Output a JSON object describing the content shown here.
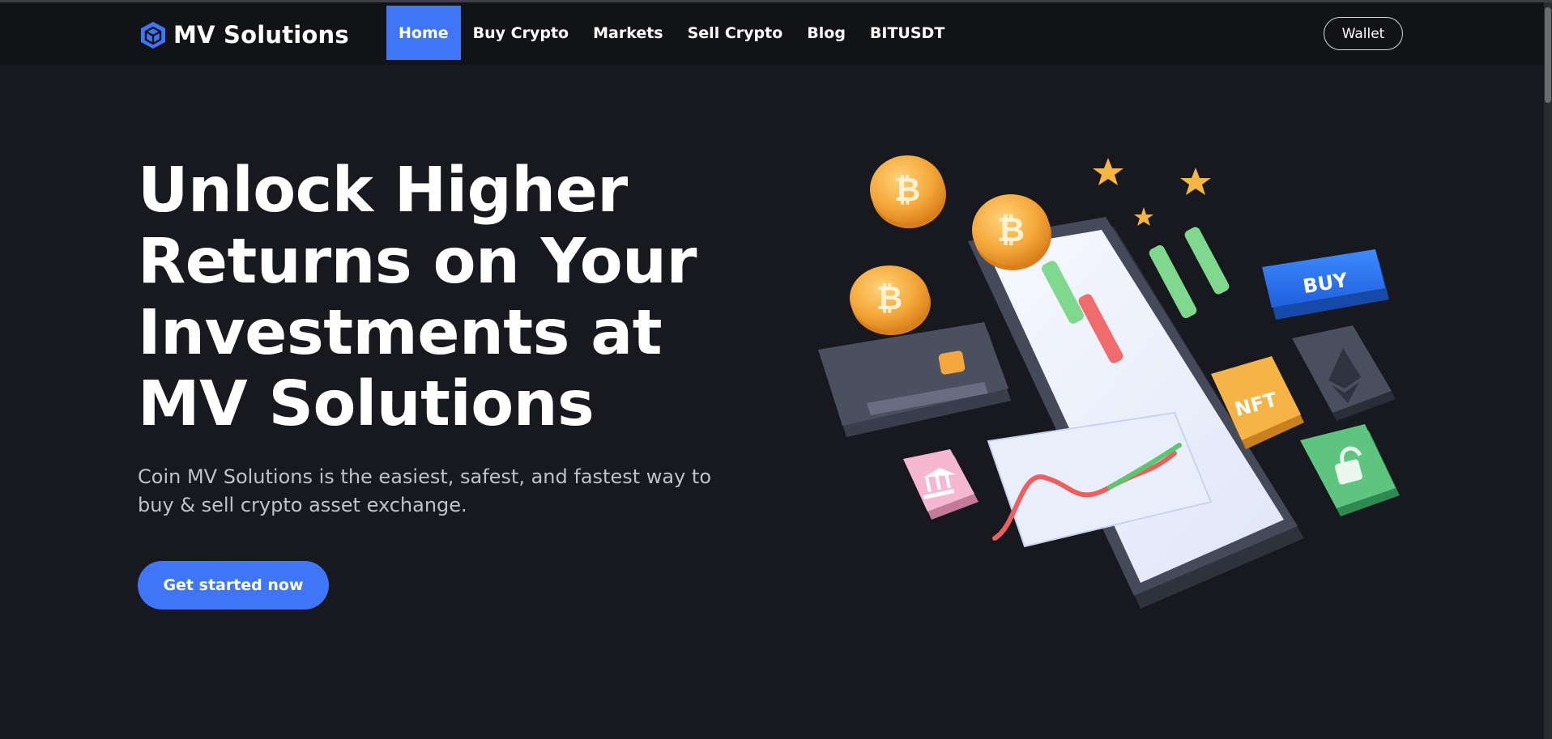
{
  "navbar": {
    "brand": "MV Solutions",
    "items": [
      {
        "label": "Home",
        "active": true
      },
      {
        "label": "Buy Crypto",
        "active": false
      },
      {
        "label": "Markets",
        "active": false
      },
      {
        "label": "Sell Crypto",
        "active": false
      },
      {
        "label": "Blog",
        "active": false
      },
      {
        "label": "BITUSDT",
        "active": false
      }
    ],
    "wallet_label": "Wallet"
  },
  "hero": {
    "title_lines": [
      "Unlock Higher",
      "Returns on Your",
      "Investments at",
      "MV Solutions"
    ],
    "subtitle": "Coin MV Solutions is the easiest, safest, and fastest way to buy & sell crypto asset exchange.",
    "cta_label": "Get started now"
  },
  "illustration": {
    "buy_tile_label": "BUY",
    "nft_tile_label": "NFT",
    "icons": [
      "bitcoin-coin-icon",
      "ethereum-icon",
      "lock-icon",
      "bank-icon",
      "credit-card-icon",
      "star-icon"
    ]
  },
  "colors": {
    "background": "#18191e",
    "navbar": "#121316",
    "accent": "#3e76f7",
    "subtitle_text": "#bfc2c8"
  }
}
